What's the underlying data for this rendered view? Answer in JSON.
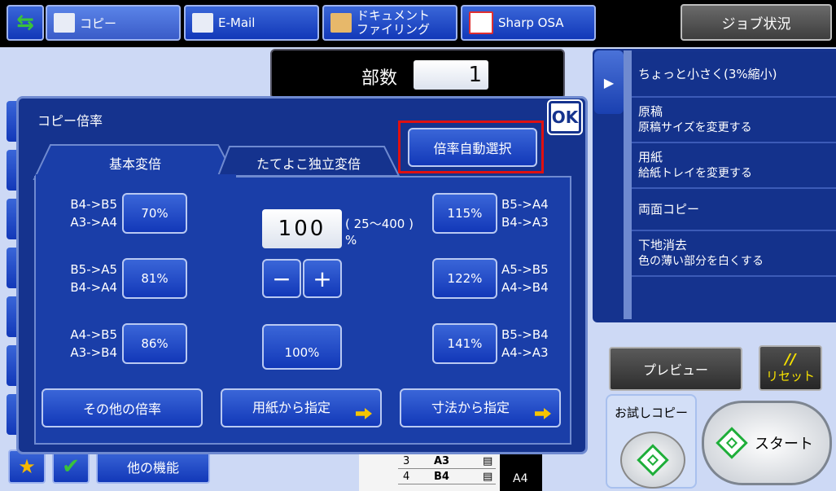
{
  "top_tabs": [
    {
      "label": "コピー",
      "icon": "copy-icon"
    },
    {
      "label": "E-Mail",
      "icon": "email-icon"
    },
    {
      "label": "ドキュメント\nファイリング",
      "icon": "document-filing-icon"
    },
    {
      "label": "Sharp OSA",
      "icon": "osa-icon"
    }
  ],
  "job_status_label": "ジョブ状況",
  "copies": {
    "label": "部数",
    "value": "1"
  },
  "right_menu": [
    {
      "title": "ちょっと小さく(3%縮小)",
      "sub": ""
    },
    {
      "title": "原稿",
      "sub": "原稿サイズを変更する"
    },
    {
      "title": "用紙",
      "sub": "給紙トレイを変更する"
    },
    {
      "title": "両面コピー",
      "sub": ""
    },
    {
      "title": "下地消去",
      "sub": "色の薄い部分を白くする"
    }
  ],
  "preview_label": "プレビュー",
  "reset": {
    "top": "//",
    "label": "リセット"
  },
  "trial_copy_label": "お試しコピー",
  "start_label": "スタート",
  "other_functions_label": "他の機能",
  "tray": {
    "rows": [
      {
        "num": "3",
        "size": "A3"
      },
      {
        "num": "4",
        "size": "B4"
      }
    ],
    "selected": "A4"
  },
  "dialog": {
    "title": "コピー倍率",
    "ok_label": "OK",
    "auto_select_label": "倍率自動選択",
    "tabs": [
      "基本変倍",
      "たてよこ独立変倍"
    ],
    "left_presets": [
      {
        "l1": "B4->B5",
        "l2": "A3->A4",
        "value": "70%"
      },
      {
        "l1": "B5->A5",
        "l2": "B4->A4",
        "value": "81%"
      },
      {
        "l1": "A4->B5",
        "l2": "A3->B4",
        "value": "86%"
      }
    ],
    "right_presets": [
      {
        "l1": "B5->A4",
        "l2": "B4->A3",
        "value": "115%"
      },
      {
        "l1": "A5->B5",
        "l2": "A4->B4",
        "value": "122%"
      },
      {
        "l1": "B5->B4",
        "l2": "A4->A3",
        "value": "141%"
      }
    ],
    "ratio_value": "100",
    "ratio_range": "( 25～400 )",
    "ratio_unit": "%",
    "minus_label": "−",
    "plus_label": "+",
    "reset_100_label": "100%",
    "bottom_buttons": [
      "その他の倍率",
      "用紙から指定",
      "寸法から指定"
    ]
  }
}
